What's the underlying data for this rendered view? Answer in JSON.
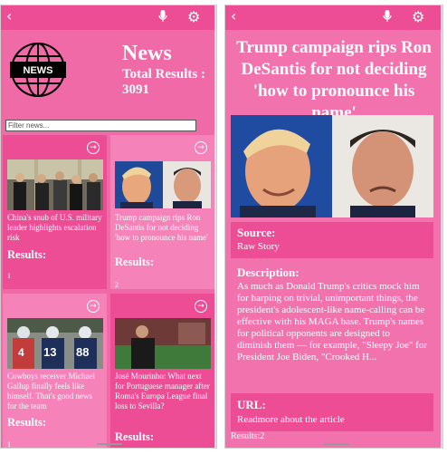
{
  "left": {
    "header": {
      "back_icon": "chevron-left-icon",
      "mic_icon": "microphone-icon",
      "settings_icon": "gear-icon"
    },
    "logo_text": "NEWS",
    "title": "News",
    "total_results_label": "Total Results :",
    "total_results_value": "3091",
    "search": {
      "placeholder": "Filter news..."
    },
    "cards": [
      {
        "title": "China's snub of U.S. military leader highlights escalation risk",
        "results_label": "Results:",
        "count": "1"
      },
      {
        "title": "Trump campaign rips Ron DeSantis for not deciding 'how to pronounce his name'",
        "results_label": "Results:",
        "count": "2"
      },
      {
        "title": "Cowboys receiver Michael Gallup finally feels like himself. That's good news for the team",
        "results_label": "Results:",
        "count": "1"
      },
      {
        "title": "José Mourinho: What next for Portuguese manager after Roma's Europa League final loss to Sevilla?",
        "results_label": "Results:",
        "count": ""
      }
    ]
  },
  "right": {
    "header": {
      "back_icon": "chevron-left-icon",
      "mic_icon": "microphone-icon",
      "settings_icon": "gear-icon"
    },
    "article_title": "Trump campaign rips Ron DeSantis for not deciding 'how to pronounce his name'",
    "source_label": "Source:",
    "source_value": "Raw Story",
    "description_label": "Description:",
    "description_value": "As much as Donald Trump's critics mock him for harping on trivial, unimportant things, the president's adolescent-like name-calling can be effective with his MAGA base. Trump's names for political opponents are designed to diminish them — for example, \"Sleepy Joe\" for President Joe Biden, \"Crooked H...",
    "url_label": "URL:",
    "url_value": "Readmore about the article",
    "results_text": "Results:2"
  },
  "colors": {
    "header": "#ec4d95",
    "background": "#f06aa8",
    "card_dark": "#ec4d95",
    "card_light": "#f582b8"
  }
}
